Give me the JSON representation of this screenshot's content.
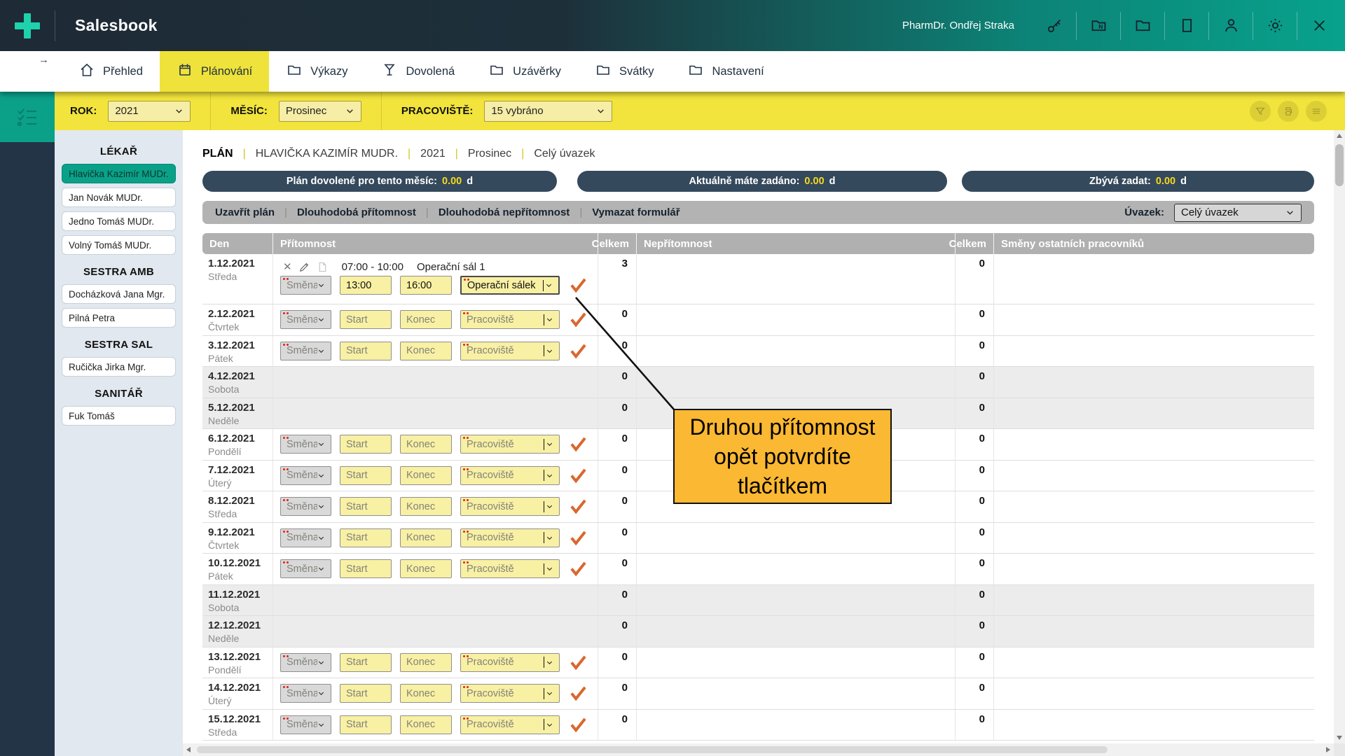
{
  "colors": {
    "teal_accent": "#0ba189",
    "header_dark": "#1e2a36",
    "header_teal": "#08a28c",
    "logo_teal": "#1ed2ad",
    "active_tab_yellow": "#efe23a",
    "filter_bar_yellow": "#f2e43c",
    "summary_pill_navy": "#35495d",
    "summary_value_yellow": "#f4d91d",
    "callout_amber": "#fbb832",
    "confirm_check_orange": "#d8682f",
    "required_marker_red": "#e02417",
    "input_yellow": "#f8f0a3"
  },
  "icons": {
    "back_arrow": "→",
    "delete": "✕"
  },
  "header": {
    "app_title": "Salesbook",
    "user_name": "PharmDr. Ondřej Straka"
  },
  "nav": {
    "tabs": [
      {
        "key": "prehled",
        "icon": "home",
        "label": "Přehled",
        "active": false
      },
      {
        "key": "planovani",
        "icon": "calendar",
        "label": "Plánování",
        "active": true
      },
      {
        "key": "vykazy",
        "icon": "folder",
        "label": "Výkazy",
        "active": false
      },
      {
        "key": "dovolena",
        "icon": "glass",
        "label": "Dovolená",
        "active": false
      },
      {
        "key": "uzaverky",
        "icon": "folder",
        "label": "Uzávěrky",
        "active": false
      },
      {
        "key": "svatky",
        "icon": "folder",
        "label": "Svátky",
        "active": false
      },
      {
        "key": "nastaveni",
        "icon": "folder",
        "label": "Nastavení",
        "active": false
      }
    ]
  },
  "filters": {
    "rok": {
      "label": "ROK:",
      "value": "2021"
    },
    "mesic": {
      "label": "MĚSÍC:",
      "value": "Prosinec"
    },
    "pracoviste": {
      "label": "PRACOVIŠTĚ:",
      "value": "15 vybráno"
    }
  },
  "sidebar": {
    "groups": [
      {
        "title": "LÉKAŘ",
        "items": [
          {
            "label": "Hlavička Kazimír MUDr.",
            "selected": true
          },
          {
            "label": "Jan Novák MUDr.",
            "selected": false
          },
          {
            "label": "Jedno Tomáš MUDr.",
            "selected": false
          },
          {
            "label": "Volný Tomáš MUDr.",
            "selected": false
          }
        ]
      },
      {
        "title": "SESTRA AMB",
        "items": [
          {
            "label": "Docházková Jana Mgr.",
            "selected": false
          },
          {
            "label": "Pilná Petra",
            "selected": false
          }
        ]
      },
      {
        "title": "SESTRA SAL",
        "items": [
          {
            "label": "Ručička Jirka Mgr.",
            "selected": false
          }
        ]
      },
      {
        "title": "SANITÁŘ",
        "items": [
          {
            "label": "Fuk Tomáš",
            "selected": false
          }
        ]
      }
    ]
  },
  "plan": {
    "breadcrumb": [
      "PLÁN",
      "HLAVIČKA KAZIMÍR MUDR.",
      "2021",
      "Prosinec",
      "Celý úvazek"
    ],
    "breadcrumb_separator": "|",
    "summary_pills": [
      {
        "label": "Plán dovolené pro tento měsíc:",
        "value": "0.00",
        "unit": "d"
      },
      {
        "label": "Aktuálně máte zadáno:",
        "value": "0.00",
        "unit": "d"
      },
      {
        "label": "Zbývá zadat:",
        "value": "0.00",
        "unit": "d"
      }
    ],
    "toolbar": {
      "actions": [
        "Uzavřít plán",
        "Dlouhodobá přítomnost",
        "Dlouhodobá nepřítomnost",
        "Vymazat formulář"
      ],
      "separator": "|",
      "uvazek_label": "Úvazek:",
      "uvazek_value": "Celý úvazek"
    }
  },
  "table": {
    "headers": [
      "Den",
      "Přítomnost",
      "Celkem",
      "Nepřítomnost",
      "Celkem",
      "Směny ostatních pracovníků"
    ],
    "form_placeholders": {
      "smena": "Směna",
      "start": "Start",
      "konec": "Konec",
      "pracoviste": "Pracoviště"
    },
    "rows": [
      {
        "date": "1.12.2021",
        "day": "Středa",
        "weekend": false,
        "has_form": true,
        "celkem": "3",
        "celkem2": "0",
        "entry": {
          "time": "07:00 - 10:00",
          "place": "Operační sál 1"
        },
        "form_values": {
          "smena": "Směna",
          "start": "13:00",
          "konec": "16:00",
          "pracoviste": "Operační sálek"
        },
        "focused_field": "pracoviste"
      },
      {
        "date": "2.12.2021",
        "day": "Čtvrtek",
        "weekend": false,
        "has_form": true,
        "celkem": "0",
        "celkem2": "0"
      },
      {
        "date": "3.12.2021",
        "day": "Pátek",
        "weekend": false,
        "has_form": true,
        "celkem": "0",
        "celkem2": "0"
      },
      {
        "date": "4.12.2021",
        "day": "Sobota",
        "weekend": true,
        "has_form": false,
        "celkem": "0",
        "celkem2": "0"
      },
      {
        "date": "5.12.2021",
        "day": "Neděle",
        "weekend": true,
        "has_form": false,
        "celkem": "0",
        "celkem2": "0"
      },
      {
        "date": "6.12.2021",
        "day": "Pondělí",
        "weekend": false,
        "has_form": true,
        "celkem": "0",
        "celkem2": "0"
      },
      {
        "date": "7.12.2021",
        "day": "Úterý",
        "weekend": false,
        "has_form": true,
        "celkem": "0",
        "celkem2": "0"
      },
      {
        "date": "8.12.2021",
        "day": "Středa",
        "weekend": false,
        "has_form": true,
        "celkem": "0",
        "celkem2": "0"
      },
      {
        "date": "9.12.2021",
        "day": "Čtvrtek",
        "weekend": false,
        "has_form": true,
        "celkem": "0",
        "celkem2": "0"
      },
      {
        "date": "10.12.2021",
        "day": "Pátek",
        "weekend": false,
        "has_form": true,
        "celkem": "0",
        "celkem2": "0"
      },
      {
        "date": "11.12.2021",
        "day": "Sobota",
        "weekend": true,
        "has_form": false,
        "celkem": "0",
        "celkem2": "0"
      },
      {
        "date": "12.12.2021",
        "day": "Neděle",
        "weekend": true,
        "has_form": false,
        "celkem": "0",
        "celkem2": "0"
      },
      {
        "date": "13.12.2021",
        "day": "Pondělí",
        "weekend": false,
        "has_form": true,
        "celkem": "0",
        "celkem2": "0"
      },
      {
        "date": "14.12.2021",
        "day": "Úterý",
        "weekend": false,
        "has_form": true,
        "celkem": "0",
        "celkem2": "0"
      },
      {
        "date": "15.12.2021",
        "day": "Středa",
        "weekend": false,
        "has_form": true,
        "celkem": "0",
        "celkem2": "0"
      }
    ]
  },
  "callout": {
    "text": "Druhou přítomnost opět potvrdíte tlačítkem"
  }
}
